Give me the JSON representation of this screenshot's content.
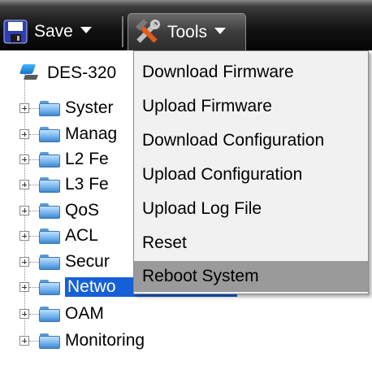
{
  "toolbar": {
    "save_label": "Save",
    "tools_label": "Tools"
  },
  "tree": {
    "root_label": "DES-320",
    "nodes": [
      {
        "label": "Syster"
      },
      {
        "label": "Manag"
      },
      {
        "label": "L2 Fe"
      },
      {
        "label": "L3 Fe"
      },
      {
        "label": "QoS"
      },
      {
        "label": "ACL"
      },
      {
        "label": "Secur"
      },
      {
        "label": "Netwo",
        "selected": true
      },
      {
        "label": "OAM"
      },
      {
        "label": "Monitoring"
      }
    ]
  },
  "tools_menu": {
    "items": [
      {
        "label": "Download Firmware"
      },
      {
        "label": "Upload Firmware"
      },
      {
        "label": "Download Configuration"
      },
      {
        "label": "Upload Configuration"
      },
      {
        "label": "Upload Log File"
      },
      {
        "label": "Reset"
      },
      {
        "label": "Reboot System",
        "highlighted": true
      }
    ]
  },
  "colors": {
    "toolbar_bg": "#111111",
    "menu_bg": "#f1f1f1",
    "menu_highlight": "#9a9a9a",
    "selection": "#1560d6"
  },
  "icons": {
    "save": "floppy-disk-icon",
    "tools": "hammer-wrench-icon",
    "folder": "folder-icon",
    "root": "switch-device-icon"
  }
}
